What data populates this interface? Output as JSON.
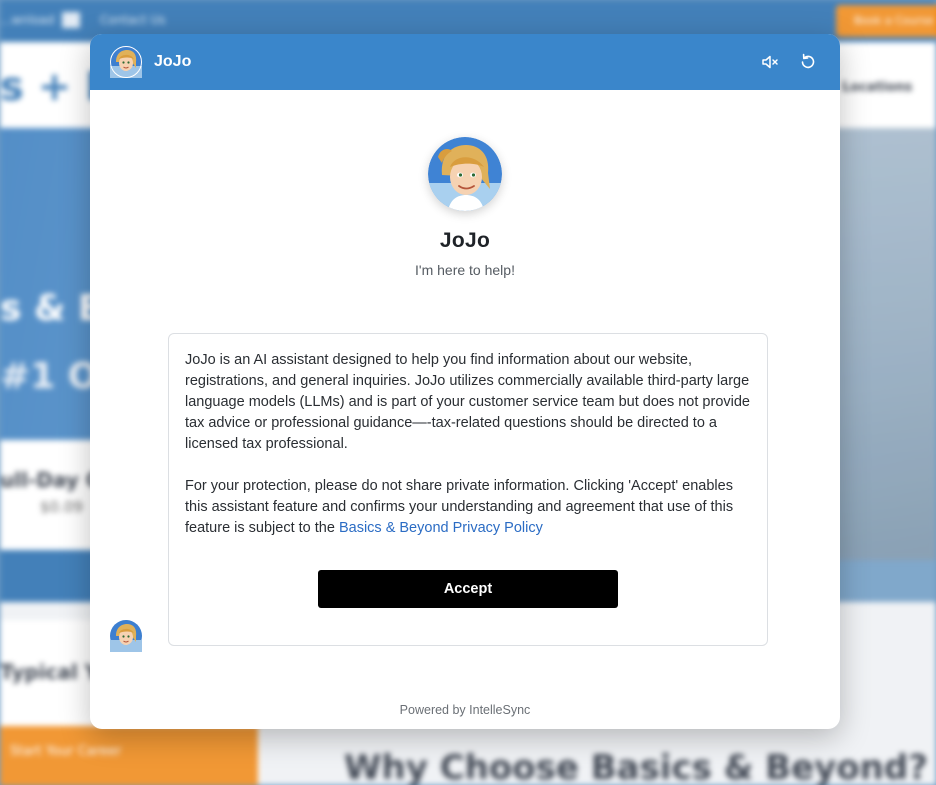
{
  "background_page": {
    "topbar_left_text": "...wnload",
    "topbar_contact": "Contact Us",
    "topbar_cta": "Book a Course",
    "logo_text": "s + Be",
    "nav_item": "Locations",
    "hero_line1": "s & Bey",
    "hero_line2": "#1 Opt",
    "card1_title": "ull-Day C",
    "card1_price": "$0.09",
    "card2_title": "Typical Y",
    "card2_cta": "Start Your Career",
    "why_heading": "Why Choose Basics & Beyond?"
  },
  "chat": {
    "header": {
      "name": "JoJo",
      "mute_icon": "speaker-muted-icon",
      "reset_icon": "refresh-icon"
    },
    "agent": {
      "name": "JoJo",
      "tagline": "I'm here to help!"
    },
    "disclaimer": {
      "paragraph1": "JoJo is an AI assistant designed to help you find information about our website, registrations, and general inquiries. JoJo utilizes commercially available third-party large language models (LLMs) and is part of your customer service team but does not provide tax advice or professional guidance—-tax-related questions should be directed to a licensed tax professional.",
      "paragraph2_prefix": "For your protection, please do not share private information. Clicking 'Accept' enables this assistant feature and confirms your understanding and agreement that use of this feature is subject to the ",
      "policy_link": "Basics & Beyond Privacy Policy",
      "accept_label": "Accept"
    },
    "footer": {
      "powered_by": "Powered by IntelleSync"
    },
    "colors": {
      "header_bg": "#3a86cb",
      "accept_bg": "#000000",
      "link": "#2b6cc4"
    }
  }
}
